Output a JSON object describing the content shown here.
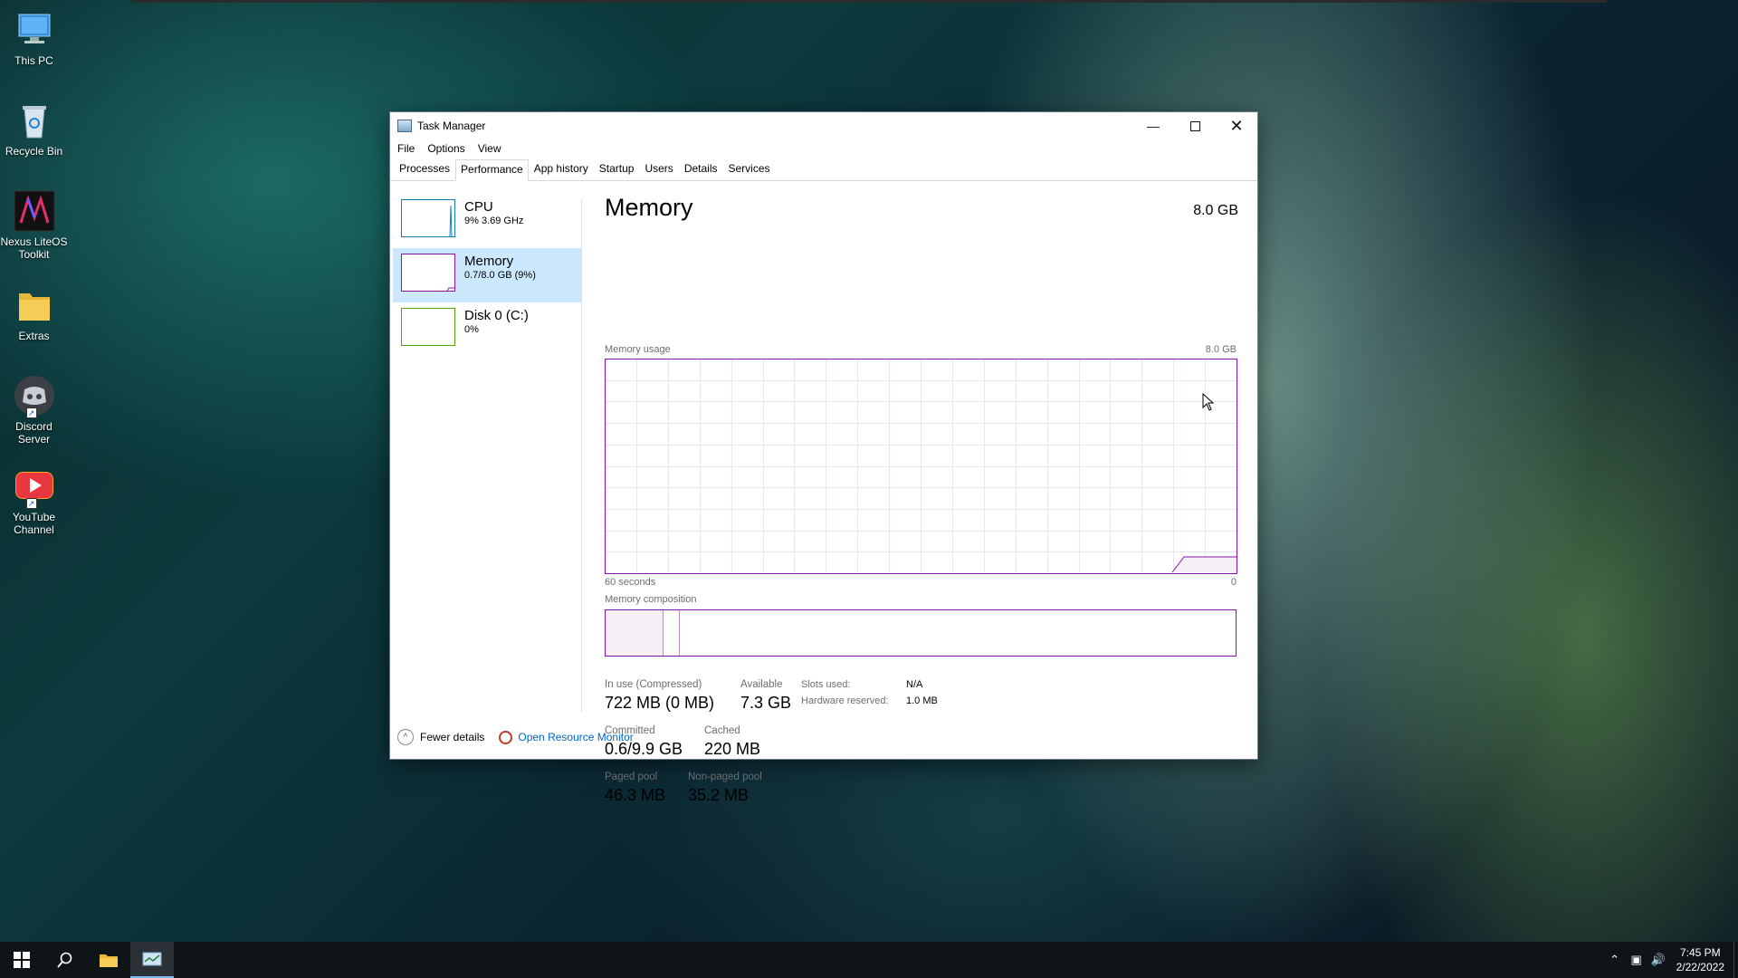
{
  "desktop": {
    "icons": [
      {
        "label": "This PC",
        "icon": "computer-icon"
      },
      {
        "label": "Recycle Bin",
        "icon": "recycle-bin-icon"
      },
      {
        "label": "Nexus LiteOS Toolkit",
        "icon": "nexus-icon"
      },
      {
        "label": "Extras",
        "icon": "folder-icon"
      },
      {
        "label": "Discord Server",
        "icon": "discord-icon"
      },
      {
        "label": "YouTube Channel",
        "icon": "youtube-icon"
      }
    ]
  },
  "window": {
    "title": "Task Manager",
    "menu": [
      "File",
      "Options",
      "View"
    ],
    "tabs": [
      "Processes",
      "Performance",
      "App history",
      "Startup",
      "Users",
      "Details",
      "Services"
    ],
    "active_tab": "Performance"
  },
  "sidebar": {
    "items": [
      {
        "title": "CPU",
        "subtitle": "9% 3.69 GHz",
        "color": "#117dbb"
      },
      {
        "title": "Memory",
        "subtitle": "0.7/8.0 GB (9%)",
        "color": "#8b12ae",
        "selected": true
      },
      {
        "title": "Disk 0 (C:)",
        "subtitle": "0%",
        "color": "#4da60c"
      }
    ]
  },
  "memory": {
    "title": "Memory",
    "total": "8.0 GB",
    "usage_label": "Memory usage",
    "usage_max": "8.0 GB",
    "time_left": "60 seconds",
    "time_right": "0",
    "composition_label": "Memory composition",
    "accent_color": "#8b12ae",
    "stats": {
      "in_use_label": "In use (Compressed)",
      "in_use_value": "722 MB (0 MB)",
      "available_label": "Available",
      "available_value": "7.3 GB",
      "committed_label": "Committed",
      "committed_value": "0.6/9.9 GB",
      "cached_label": "Cached",
      "cached_value": "220 MB",
      "paged_label": "Paged pool",
      "paged_value": "46.3 MB",
      "nonpaged_label": "Non-paged pool",
      "nonpaged_value": "35.2 MB"
    },
    "details": {
      "slots_label": "Slots used:",
      "slots_value": "N/A",
      "hw_reserved_label": "Hardware reserved:",
      "hw_reserved_value": "1.0 MB"
    }
  },
  "footer": {
    "fewer_details": "Fewer details",
    "open_resource_monitor": "Open Resource Monitor"
  },
  "taskbar": {
    "time": "7:45 PM",
    "date": "2/22/2022"
  }
}
